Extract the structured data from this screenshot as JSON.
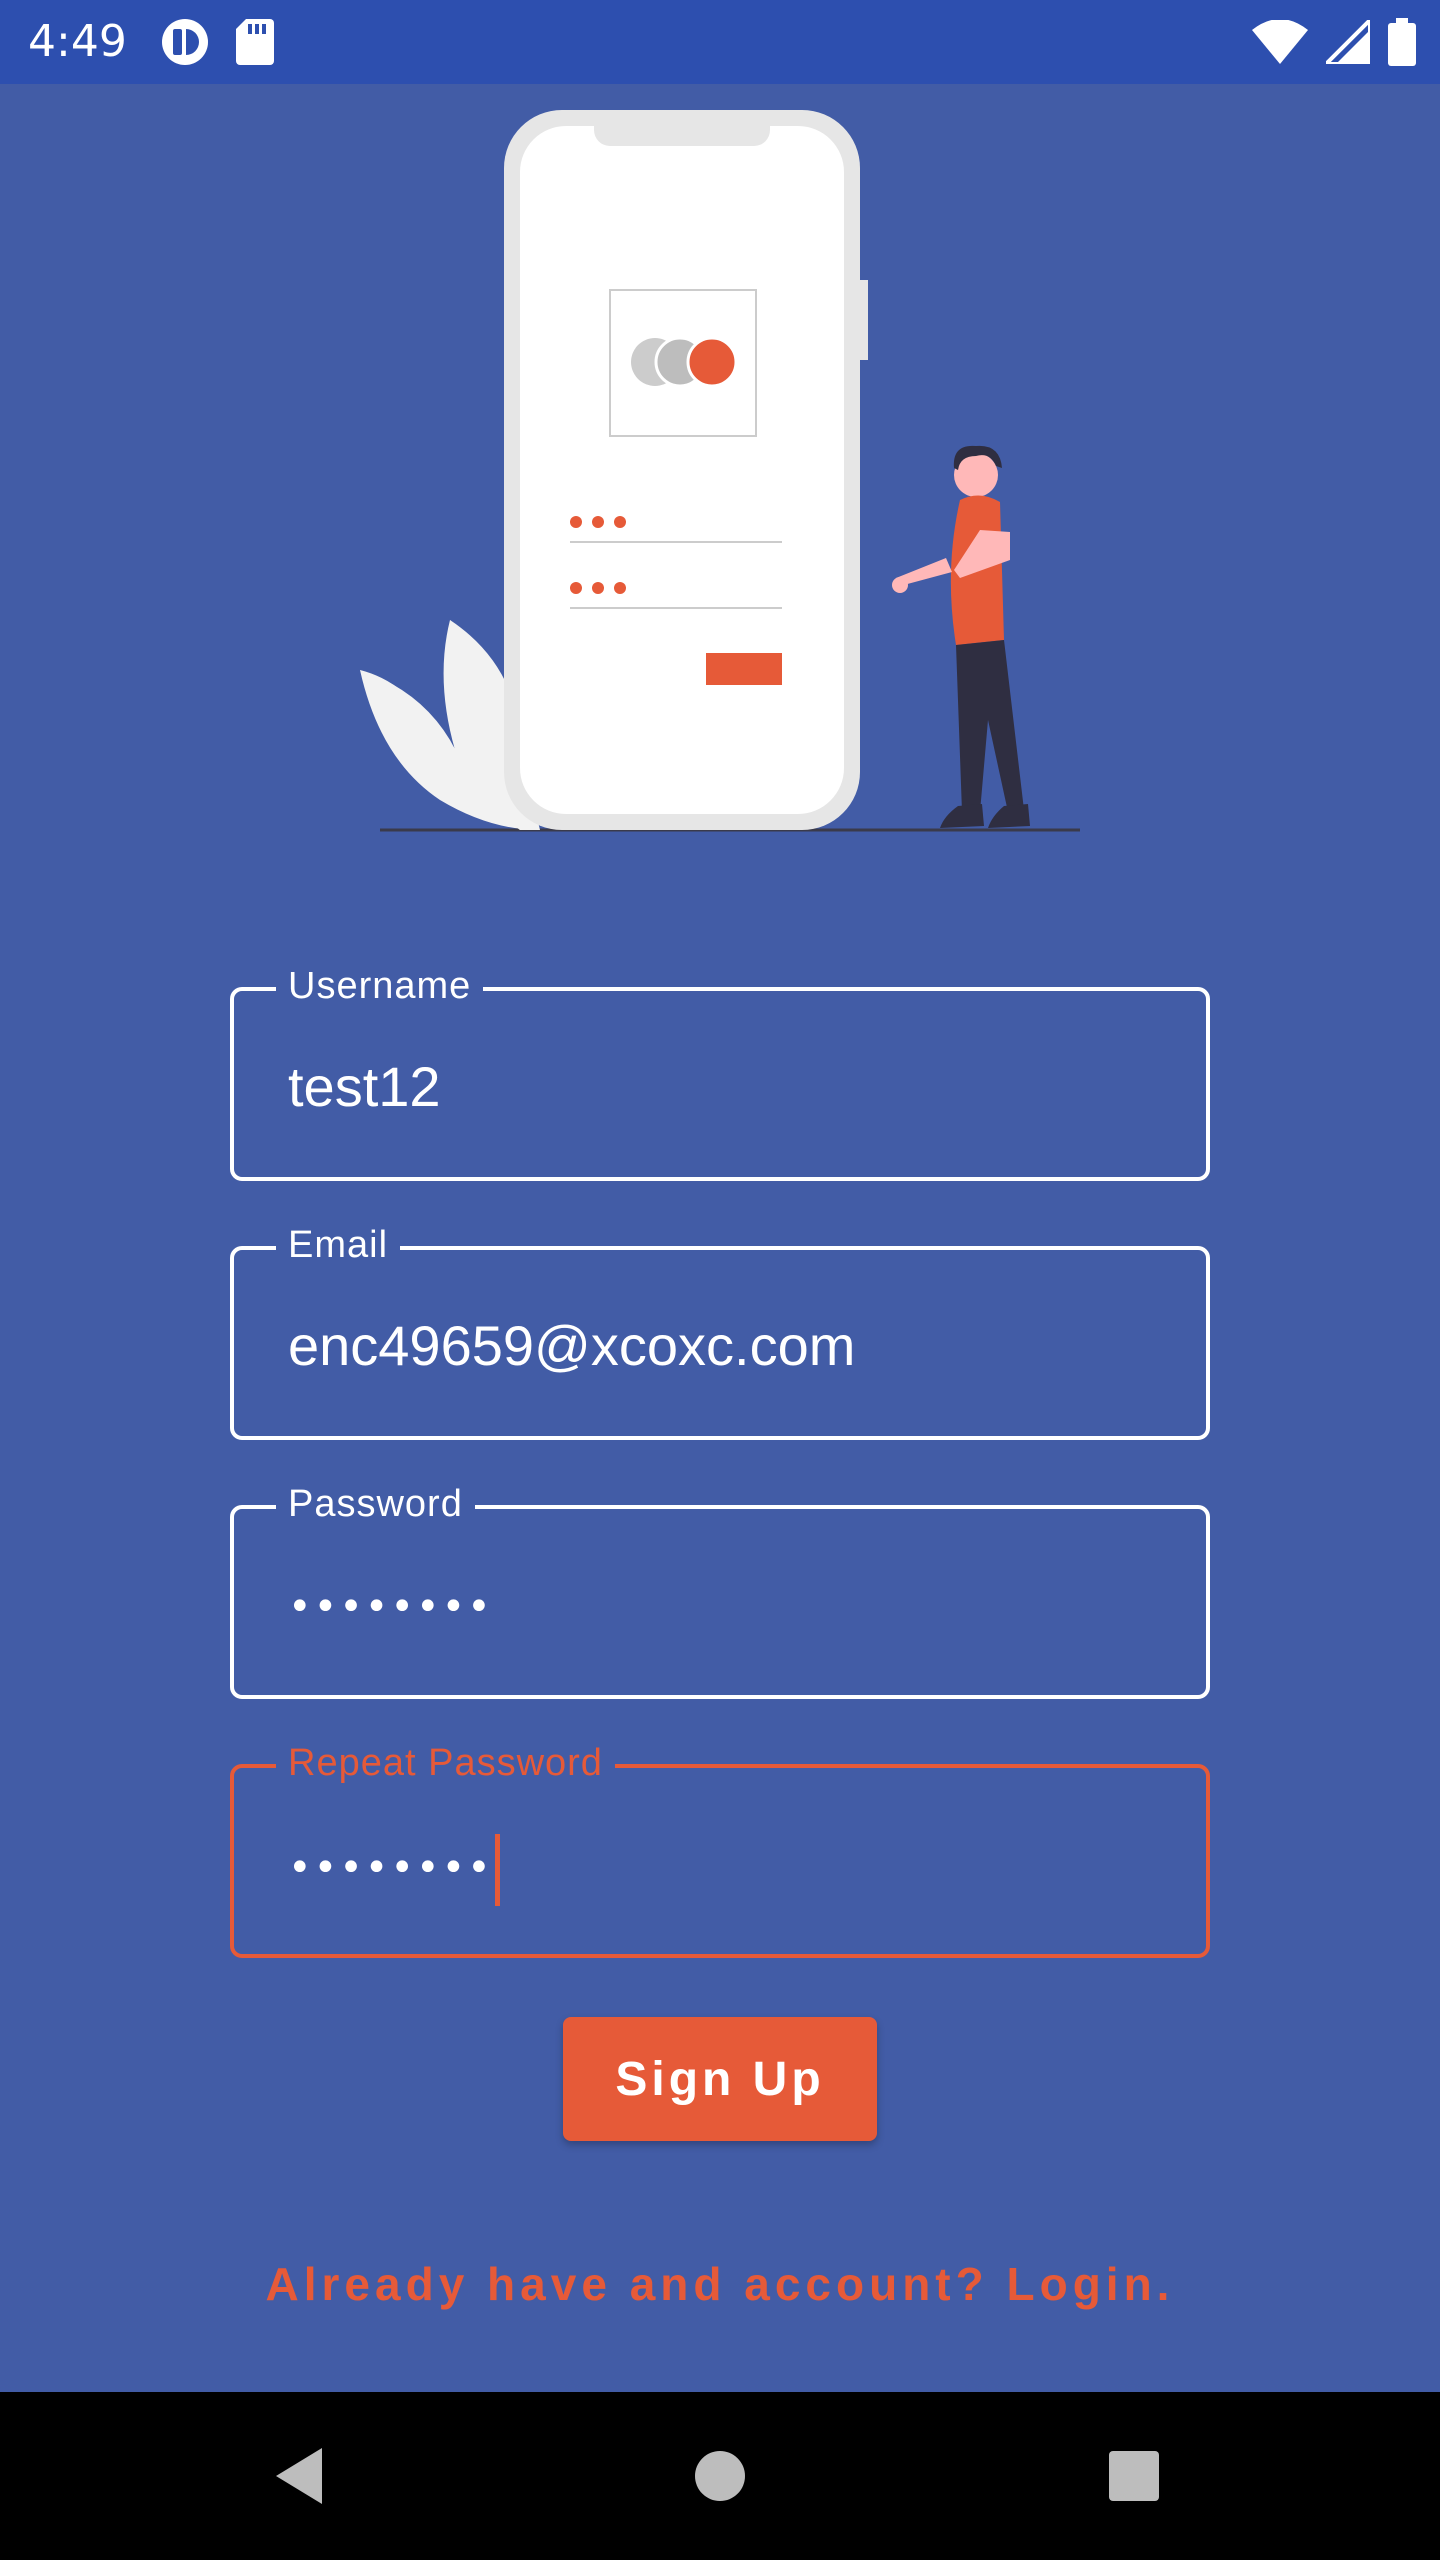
{
  "status_bar": {
    "time": "4:49",
    "left_icons": [
      "sync-app-icon",
      "sd-card-icon"
    ],
    "right_icons": [
      "wifi-icon",
      "cell-signal-icon",
      "battery-icon"
    ]
  },
  "form": {
    "username": {
      "label": "Username",
      "value": "test12"
    },
    "email": {
      "label": "Email",
      "value": "enc49659@xcoxc.com"
    },
    "password": {
      "label": "Password",
      "value": "••••••••"
    },
    "repeat_password": {
      "label": "Repeat Password",
      "value": "••••••••",
      "focused": true
    }
  },
  "signup_button": {
    "label": "Sign Up"
  },
  "login_link": {
    "label": "Already have and account? Login."
  },
  "colors": {
    "background": "#425CA6",
    "status_bar": "#2D4FAF",
    "accent": "#E65A38",
    "text": "#FFFFFF"
  },
  "nav_bar": {
    "icons": [
      "back-icon",
      "home-icon",
      "recents-icon"
    ]
  }
}
